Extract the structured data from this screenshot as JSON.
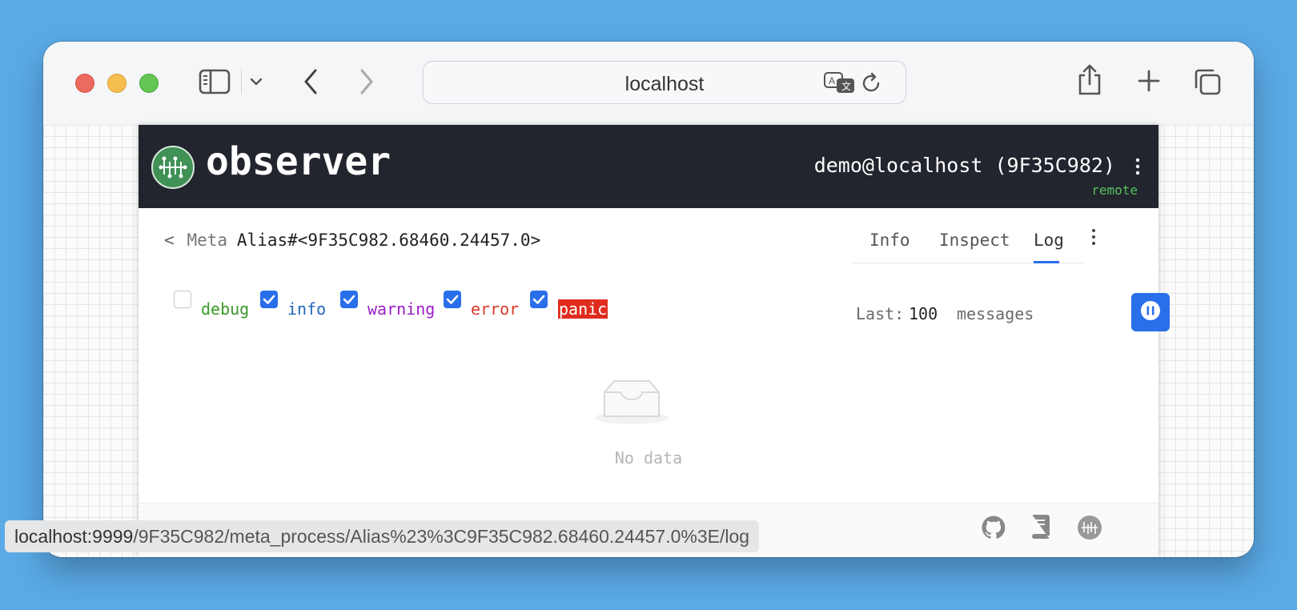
{
  "browser": {
    "url": "localhost",
    "hover_url_host": "localhost:9999",
    "hover_url_path": "/9F35C982/meta_process/Alias%23%3C9F35C982.68460.24457.0%3E/log"
  },
  "header": {
    "brand": "observer",
    "node": "demo@localhost (9F35C982)",
    "mode": "remote"
  },
  "breadcrumb": {
    "back": "<",
    "section": "Meta",
    "process": "Alias#<9F35C982.68460.24457.0>"
  },
  "tabs": [
    {
      "label": "Info",
      "active": false
    },
    {
      "label": "Inspect",
      "active": false
    },
    {
      "label": "Log",
      "active": true
    }
  ],
  "levels": [
    {
      "label": "debug",
      "checked": false,
      "color": "#3a9a2a"
    },
    {
      "label": "info",
      "checked": true,
      "color": "#2266b8"
    },
    {
      "label": "warning",
      "checked": true,
      "color": "#9b1ec6"
    },
    {
      "label": "error",
      "checked": true,
      "color": "#d63a2a"
    },
    {
      "label": "panic",
      "checked": true,
      "color": "#ffffff",
      "bg": "#e02c1e"
    }
  ],
  "limit": {
    "prefix": "Last:",
    "value": "100",
    "suffix": "messages"
  },
  "empty": {
    "text": "No data"
  },
  "colors": {
    "accent": "#2a6fea",
    "header_bg": "#22252d",
    "brand_green": "#3f9156"
  },
  "icons": [
    "sidebar-icon",
    "chevron-down-icon",
    "back-icon",
    "forward-icon",
    "translate-icon",
    "reload-icon",
    "share-icon",
    "plus-icon",
    "tabs-icon",
    "pause-icon",
    "github-icon",
    "book-icon",
    "observer-icon",
    "inbox-icon"
  ]
}
